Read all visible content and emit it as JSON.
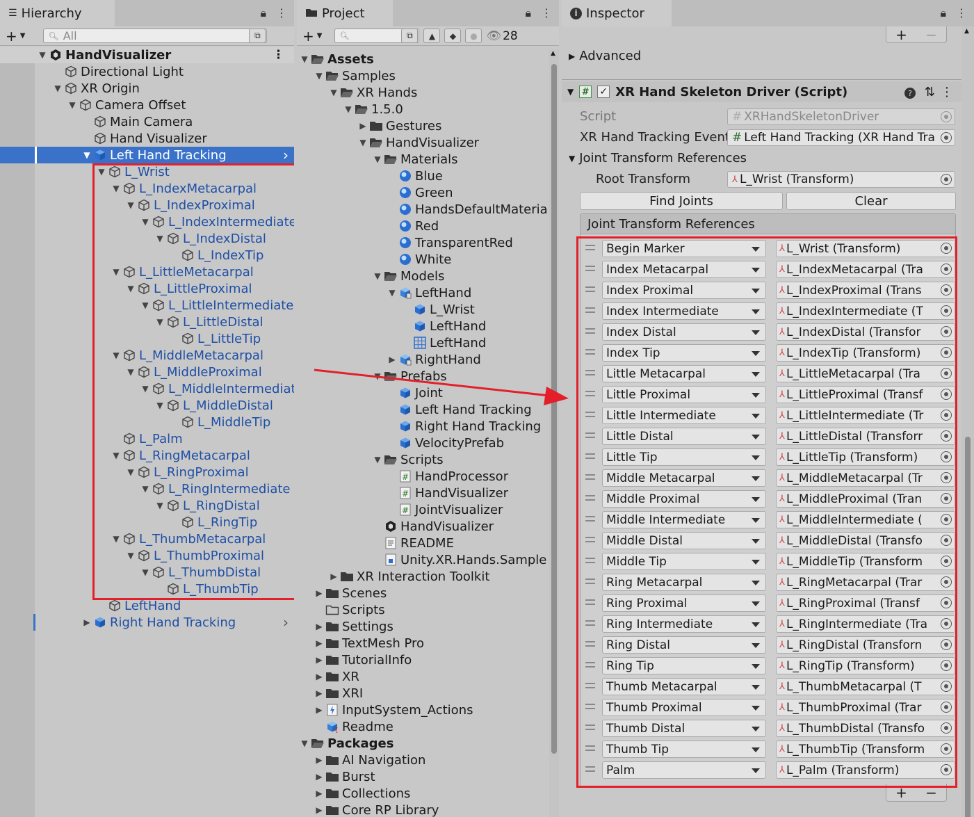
{
  "hierarchy": {
    "tab_label": "Hierarchy",
    "search_placeholder": "All",
    "root": "HandVisualizer",
    "items": [
      {
        "label": "Directional Light",
        "depth": 1,
        "arrow": "",
        "icon": "gameobject"
      },
      {
        "label": "XR Origin",
        "depth": 1,
        "arrow": "down",
        "icon": "gameobject"
      },
      {
        "label": "Camera Offset",
        "depth": 2,
        "arrow": "down",
        "icon": "gameobject"
      },
      {
        "label": "Main Camera",
        "depth": 3,
        "arrow": "",
        "icon": "gameobject"
      },
      {
        "label": "Hand Visualizer",
        "depth": 3,
        "arrow": "",
        "icon": "gameobject"
      },
      {
        "label": "Left Hand Tracking",
        "depth": 3,
        "arrow": "down",
        "icon": "prefab",
        "selected": true
      },
      {
        "label": "L_Wrist",
        "depth": 4,
        "arrow": "down",
        "icon": "gameobject",
        "blue": true
      },
      {
        "label": "L_IndexMetacarpal",
        "depth": 5,
        "arrow": "down",
        "icon": "gameobject",
        "blue": true
      },
      {
        "label": "L_IndexProximal",
        "depth": 6,
        "arrow": "down",
        "icon": "gameobject",
        "blue": true
      },
      {
        "label": "L_IndexIntermediate",
        "depth": 7,
        "arrow": "down",
        "icon": "gameobject",
        "blue": true
      },
      {
        "label": "L_IndexDistal",
        "depth": 8,
        "arrow": "down",
        "icon": "gameobject",
        "blue": true
      },
      {
        "label": "L_IndexTip",
        "depth": 9,
        "arrow": "",
        "icon": "gameobject",
        "blue": true
      },
      {
        "label": "L_LittleMetacarpal",
        "depth": 5,
        "arrow": "down",
        "icon": "gameobject",
        "blue": true
      },
      {
        "label": "L_LittleProximal",
        "depth": 6,
        "arrow": "down",
        "icon": "gameobject",
        "blue": true
      },
      {
        "label": "L_LittleIntermediate",
        "depth": 7,
        "arrow": "down",
        "icon": "gameobject",
        "blue": true
      },
      {
        "label": "L_LittleDistal",
        "depth": 8,
        "arrow": "down",
        "icon": "gameobject",
        "blue": true
      },
      {
        "label": "L_LittleTip",
        "depth": 9,
        "arrow": "",
        "icon": "gameobject",
        "blue": true
      },
      {
        "label": "L_MiddleMetacarpal",
        "depth": 5,
        "arrow": "down",
        "icon": "gameobject",
        "blue": true
      },
      {
        "label": "L_MiddleProximal",
        "depth": 6,
        "arrow": "down",
        "icon": "gameobject",
        "blue": true
      },
      {
        "label": "L_MiddleIntermediate",
        "depth": 7,
        "arrow": "down",
        "icon": "gameobject",
        "blue": true
      },
      {
        "label": "L_MiddleDistal",
        "depth": 8,
        "arrow": "down",
        "icon": "gameobject",
        "blue": true
      },
      {
        "label": "L_MiddleTip",
        "depth": 9,
        "arrow": "",
        "icon": "gameobject",
        "blue": true
      },
      {
        "label": "L_Palm",
        "depth": 5,
        "arrow": "",
        "icon": "gameobject",
        "blue": true
      },
      {
        "label": "L_RingMetacarpal",
        "depth": 5,
        "arrow": "down",
        "icon": "gameobject",
        "blue": true
      },
      {
        "label": "L_RingProximal",
        "depth": 6,
        "arrow": "down",
        "icon": "gameobject",
        "blue": true
      },
      {
        "label": "L_RingIntermediate",
        "depth": 7,
        "arrow": "down",
        "icon": "gameobject",
        "blue": true
      },
      {
        "label": "L_RingDistal",
        "depth": 8,
        "arrow": "down",
        "icon": "gameobject",
        "blue": true
      },
      {
        "label": "L_RingTip",
        "depth": 9,
        "arrow": "",
        "icon": "gameobject",
        "blue": true
      },
      {
        "label": "L_ThumbMetacarpal",
        "depth": 5,
        "arrow": "down",
        "icon": "gameobject",
        "blue": true
      },
      {
        "label": "L_ThumbProximal",
        "depth": 6,
        "arrow": "down",
        "icon": "gameobject",
        "blue": true
      },
      {
        "label": "L_ThumbDistal",
        "depth": 7,
        "arrow": "down",
        "icon": "gameobject",
        "blue": true
      },
      {
        "label": "L_ThumbTip",
        "depth": 8,
        "arrow": "",
        "icon": "gameobject",
        "blue": true
      },
      {
        "label": "LeftHand",
        "depth": 4,
        "arrow": "",
        "icon": "gameobject",
        "blue": true
      },
      {
        "label": "Right Hand Tracking",
        "depth": 3,
        "arrow": "right",
        "icon": "prefab",
        "blue": true,
        "chevron": true
      }
    ]
  },
  "project": {
    "tab_label": "Project",
    "hidden_count": "28",
    "items": [
      {
        "label": "Assets",
        "depth": 0,
        "arrow": "down",
        "icon": "folder-open",
        "bold": true
      },
      {
        "label": "Samples",
        "depth": 1,
        "arrow": "down",
        "icon": "folder-open"
      },
      {
        "label": "XR Hands",
        "depth": 2,
        "arrow": "down",
        "icon": "folder-open"
      },
      {
        "label": "1.5.0",
        "depth": 3,
        "arrow": "down",
        "icon": "folder-open"
      },
      {
        "label": "Gestures",
        "depth": 4,
        "arrow": "right",
        "icon": "folder"
      },
      {
        "label": "HandVisualizer",
        "depth": 4,
        "arrow": "down",
        "icon": "folder-open"
      },
      {
        "label": "Materials",
        "depth": 5,
        "arrow": "down",
        "icon": "folder-open"
      },
      {
        "label": "Blue",
        "depth": 6,
        "arrow": "",
        "icon": "material"
      },
      {
        "label": "Green",
        "depth": 6,
        "arrow": "",
        "icon": "material"
      },
      {
        "label": "HandsDefaultMateria",
        "depth": 6,
        "arrow": "",
        "icon": "material"
      },
      {
        "label": "Red",
        "depth": 6,
        "arrow": "",
        "icon": "material"
      },
      {
        "label": "TransparentRed",
        "depth": 6,
        "arrow": "",
        "icon": "material"
      },
      {
        "label": "White",
        "depth": 6,
        "arrow": "",
        "icon": "material"
      },
      {
        "label": "Models",
        "depth": 5,
        "arrow": "down",
        "icon": "folder-open"
      },
      {
        "label": "LeftHand",
        "depth": 6,
        "arrow": "down",
        "icon": "model"
      },
      {
        "label": "L_Wrist",
        "depth": 7,
        "arrow": "",
        "icon": "prefab"
      },
      {
        "label": "LeftHand",
        "depth": 7,
        "arrow": "",
        "icon": "prefab"
      },
      {
        "label": "LeftHand",
        "depth": 7,
        "arrow": "",
        "icon": "grid"
      },
      {
        "label": "RightHand",
        "depth": 6,
        "arrow": "right",
        "icon": "model"
      },
      {
        "label": "Prefabs",
        "depth": 5,
        "arrow": "down",
        "icon": "folder-open"
      },
      {
        "label": "Joint",
        "depth": 6,
        "arrow": "",
        "icon": "prefab"
      },
      {
        "label": "Left Hand Tracking",
        "depth": 6,
        "arrow": "",
        "icon": "prefab"
      },
      {
        "label": "Right Hand Tracking",
        "depth": 6,
        "arrow": "",
        "icon": "prefab"
      },
      {
        "label": "VelocityPrefab",
        "depth": 6,
        "arrow": "",
        "icon": "prefab"
      },
      {
        "label": "Scripts",
        "depth": 5,
        "arrow": "down",
        "icon": "folder-open"
      },
      {
        "label": "HandProcessor",
        "depth": 6,
        "arrow": "",
        "icon": "script"
      },
      {
        "label": "HandVisualizer",
        "depth": 6,
        "arrow": "",
        "icon": "script"
      },
      {
        "label": "JointVisualizer",
        "depth": 6,
        "arrow": "",
        "icon": "script"
      },
      {
        "label": "HandVisualizer",
        "depth": 5,
        "arrow": "",
        "icon": "unity"
      },
      {
        "label": "README",
        "depth": 5,
        "arrow": "",
        "icon": "text"
      },
      {
        "label": "Unity.XR.Hands.Sample",
        "depth": 5,
        "arrow": "",
        "icon": "asmdef"
      },
      {
        "label": "XR Interaction Toolkit",
        "depth": 2,
        "arrow": "right",
        "icon": "folder"
      },
      {
        "label": "Scenes",
        "depth": 1,
        "arrow": "right",
        "icon": "folder"
      },
      {
        "label": "Scripts",
        "depth": 1,
        "arrow": "",
        "icon": "folder-empty"
      },
      {
        "label": "Settings",
        "depth": 1,
        "arrow": "right",
        "icon": "folder"
      },
      {
        "label": "TextMesh Pro",
        "depth": 1,
        "arrow": "right",
        "icon": "folder"
      },
      {
        "label": "TutorialInfo",
        "depth": 1,
        "arrow": "right",
        "icon": "folder"
      },
      {
        "label": "XR",
        "depth": 1,
        "arrow": "right",
        "icon": "folder"
      },
      {
        "label": "XRI",
        "depth": 1,
        "arrow": "right",
        "icon": "folder"
      },
      {
        "label": "InputSystem_Actions",
        "depth": 1,
        "arrow": "right",
        "icon": "inputactions"
      },
      {
        "label": "Readme",
        "depth": 1,
        "arrow": "",
        "icon": "readme"
      },
      {
        "label": "Packages",
        "depth": 0,
        "arrow": "down",
        "icon": "folder-open",
        "bold": true
      },
      {
        "label": "AI Navigation",
        "depth": 1,
        "arrow": "right",
        "icon": "folder"
      },
      {
        "label": "Burst",
        "depth": 1,
        "arrow": "right",
        "icon": "folder"
      },
      {
        "label": "Collections",
        "depth": 1,
        "arrow": "right",
        "icon": "folder"
      },
      {
        "label": "Core RP Library",
        "depth": 1,
        "arrow": "right",
        "icon": "folder"
      }
    ]
  },
  "inspector": {
    "tab_label": "Inspector",
    "advanced_label": "Advanced",
    "component_title": "XR Hand Skeleton Driver (Script)",
    "script_label": "Script",
    "script_value": "XRHandSkeletonDriver",
    "event_label": "XR Hand Tracking Event",
    "event_value": "Left Hand Tracking (XR Hand Tra",
    "section_label": "Joint Transform References",
    "root_label": "Root Transform",
    "root_value": "L_Wrist (Transform)",
    "find_joints": "Find Joints",
    "clear": "Clear",
    "list_header": "Joint Transform References",
    "joints": [
      {
        "id": "Begin Marker",
        "ref": "L_Wrist (Transform)"
      },
      {
        "id": "Index Metacarpal",
        "ref": "L_IndexMetacarpal (Tra"
      },
      {
        "id": "Index Proximal",
        "ref": "L_IndexProximal (Trans"
      },
      {
        "id": "Index Intermediate",
        "ref": "L_IndexIntermediate (T"
      },
      {
        "id": "Index Distal",
        "ref": "L_IndexDistal (Transfor"
      },
      {
        "id": "Index Tip",
        "ref": "L_IndexTip (Transform)"
      },
      {
        "id": "Little Metacarpal",
        "ref": "L_LittleMetacarpal (Tra"
      },
      {
        "id": "Little Proximal",
        "ref": "L_LittleProximal (Transf"
      },
      {
        "id": "Little Intermediate",
        "ref": "L_LittleIntermediate (Tr"
      },
      {
        "id": "Little Distal",
        "ref": "L_LittleDistal (Transforr"
      },
      {
        "id": "Little Tip",
        "ref": "L_LittleTip (Transform)"
      },
      {
        "id": "Middle Metacarpal",
        "ref": "L_MiddleMetacarpal (Tr"
      },
      {
        "id": "Middle Proximal",
        "ref": "L_MiddleProximal (Tran"
      },
      {
        "id": "Middle Intermediate",
        "ref": "L_MiddleIntermediate ("
      },
      {
        "id": "Middle Distal",
        "ref": "L_MiddleDistal (Transfo"
      },
      {
        "id": "Middle Tip",
        "ref": "L_MiddleTip (Transform"
      },
      {
        "id": "Ring Metacarpal",
        "ref": "L_RingMetacarpal (Trar"
      },
      {
        "id": "Ring Proximal",
        "ref": "L_RingProximal (Transf"
      },
      {
        "id": "Ring Intermediate",
        "ref": "L_RingIntermediate (Tra"
      },
      {
        "id": "Ring Distal",
        "ref": "L_RingDistal (Transforn"
      },
      {
        "id": "Ring Tip",
        "ref": "L_RingTip (Transform)"
      },
      {
        "id": "Thumb Metacarpal",
        "ref": "L_ThumbMetacarpal (T"
      },
      {
        "id": "Thumb Proximal",
        "ref": "L_ThumbProximal (Trar"
      },
      {
        "id": "Thumb Distal",
        "ref": "L_ThumbDistal (Transfo"
      },
      {
        "id": "Thumb Tip",
        "ref": "L_ThumbTip (Transform"
      },
      {
        "id": "Palm",
        "ref": "L_Palm (Transform)"
      }
    ]
  },
  "colors": {
    "annotation_red": "#e3202a",
    "selection_blue": "#3a72c9",
    "prefab_text_blue": "#1e4fa5"
  }
}
